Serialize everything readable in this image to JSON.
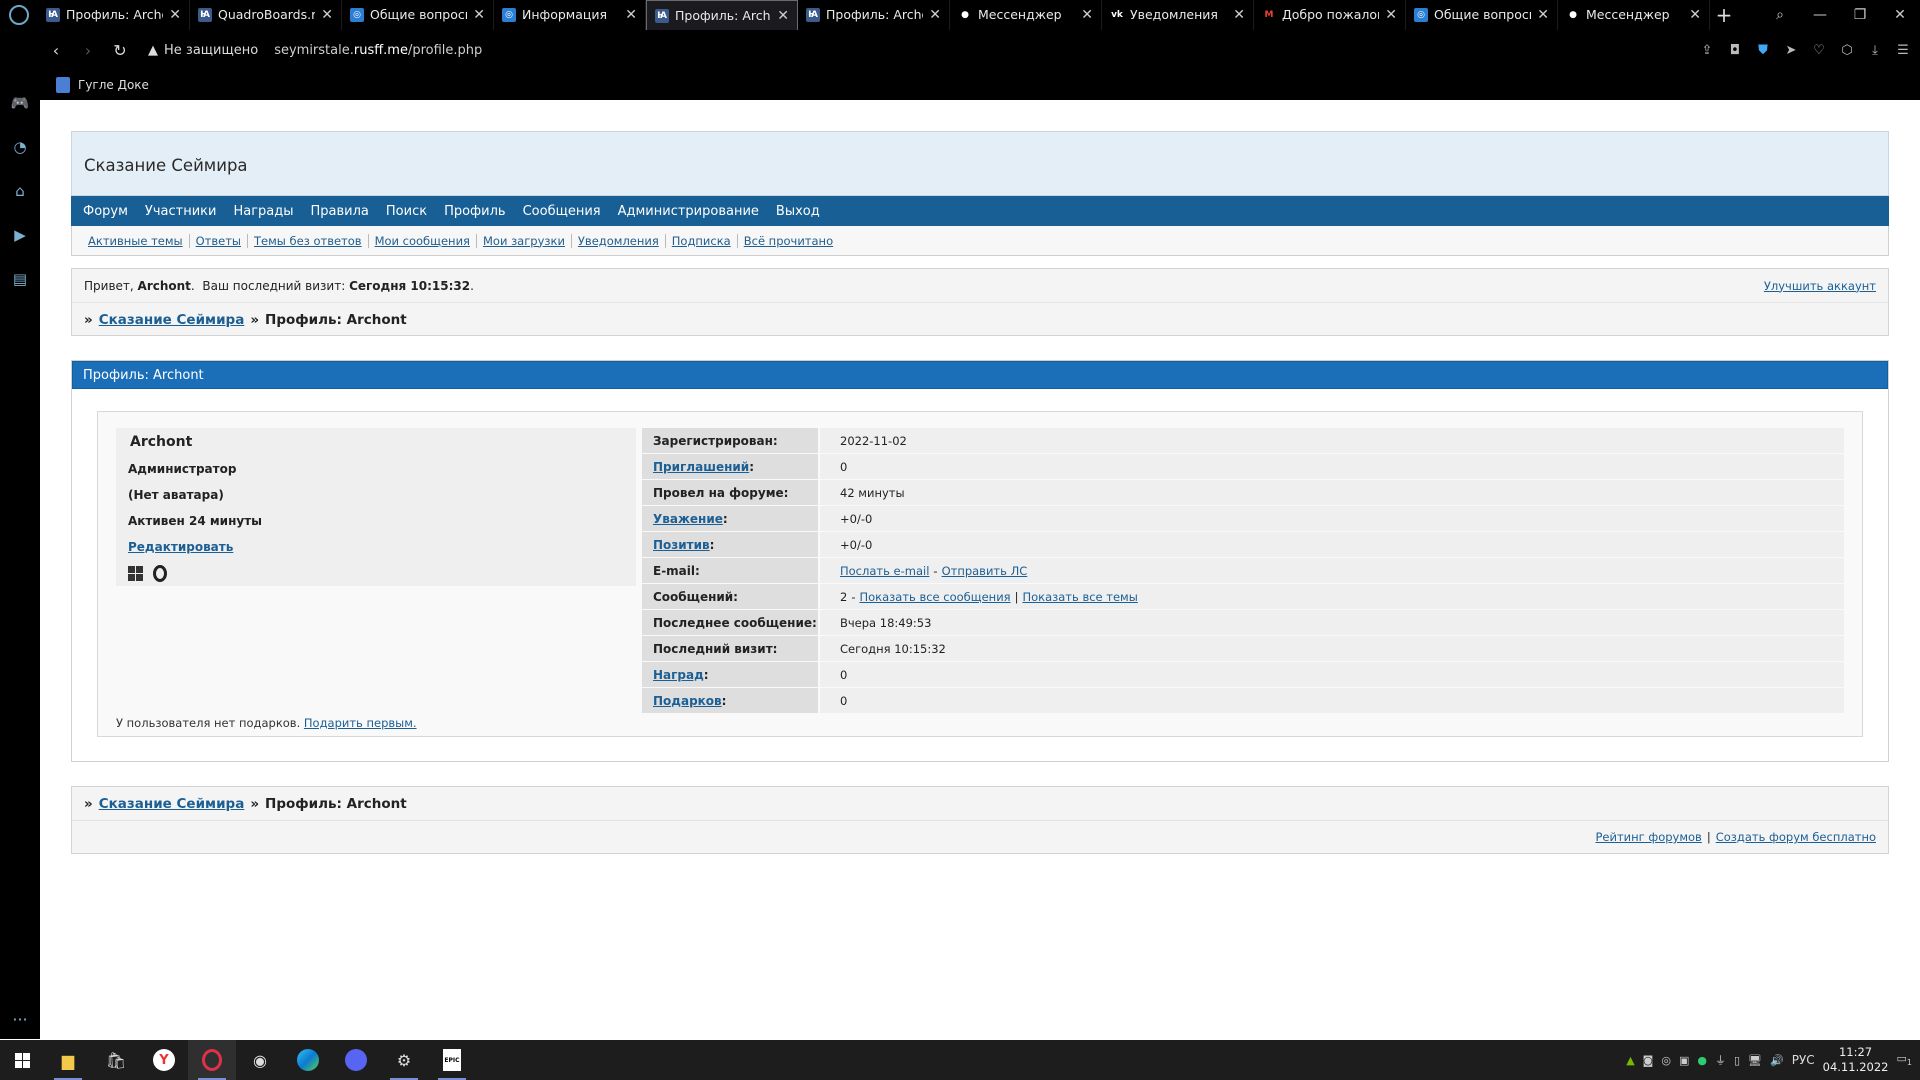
{
  "browser": {
    "tabs": [
      {
        "label": "Профиль: Archont",
        "favicon": "rusff",
        "active": false
      },
      {
        "label": "QuadroBoards.ru",
        "favicon": "rusff",
        "active": false
      },
      {
        "label": "Общие вопросы",
        "favicon": "quadro",
        "active": false
      },
      {
        "label": "Информация",
        "favicon": "quadro",
        "active": false
      },
      {
        "label": "Профиль: Archont",
        "favicon": "rusff",
        "active": true
      },
      {
        "label": "Профиль: Archont",
        "favicon": "rusff",
        "active": false
      },
      {
        "label": "Мессенджер",
        "favicon": "messenger",
        "active": false
      },
      {
        "label": "Уведомления",
        "favicon": "vk",
        "active": false
      },
      {
        "label": "Добро пожаловать",
        "favicon": "gmail",
        "active": false
      },
      {
        "label": "Общие вопросы",
        "favicon": "quadro",
        "active": false
      },
      {
        "label": "Мессенджер",
        "favicon": "messenger",
        "active": false
      }
    ],
    "security_label": "Не защищено",
    "url_prefix": "seymirstale.",
    "url_host": "rusff.me",
    "url_path": "/profile.php",
    "bookmark": "Гугле Доке"
  },
  "forum": {
    "title": "Сказание Сеймира",
    "nav": [
      "Форум",
      "Участники",
      "Награды",
      "Правила",
      "Поиск",
      "Профиль",
      "Сообщения",
      "Администрирование",
      "Выход"
    ],
    "subnav": [
      "Активные темы",
      "Ответы",
      "Темы без ответов",
      "Мои сообщения",
      "Мои загрузки",
      "Уведомления",
      "Подписка",
      "Всё прочитано"
    ],
    "welcome": {
      "greeting": "Привет,",
      "user": "Archont",
      "last_visit_label": "Ваш последний визит:",
      "last_visit_value": "Сегодня 10:15:32",
      "upgrade": "Улучшить аккаунт"
    },
    "breadcrumb": {
      "sep": "»",
      "home": "Сказание Сеймира",
      "current": "Профиль: Archont"
    }
  },
  "profile": {
    "heading": "Профиль: Archont",
    "username": "Archont",
    "role": "Администратор",
    "avatar": "(Нет аватара)",
    "active": "Активен 24 минуты",
    "edit": "Редактировать",
    "os_icons": [
      "windows-icon",
      "opera-icon"
    ],
    "gifts_text": "У пользователя нет подарков.",
    "gifts_link": "Подарить первым.",
    "stats": [
      {
        "key": "Зарегистрирован:",
        "link": false,
        "value": "2022-11-02"
      },
      {
        "key": "Приглашений",
        "link": true,
        "value": "0"
      },
      {
        "key": "Провел на форуме:",
        "link": false,
        "value": "42 минуты"
      },
      {
        "key": "Уважение",
        "link": true,
        "value": "+0/-0"
      },
      {
        "key": "Позитив",
        "link": true,
        "value": "+0/-0"
      },
      {
        "key": "E-mail:",
        "link": false,
        "value": ""
      },
      {
        "key": "Сообщений:",
        "link": false,
        "value": "2"
      },
      {
        "key": "Последнее сообщение:",
        "link": false,
        "value": "Вчера 18:49:53"
      },
      {
        "key": "Последний визит:",
        "link": false,
        "value": "Сегодня 10:15:32"
      },
      {
        "key": "Наград",
        "link": true,
        "value": "0"
      },
      {
        "key": "Подарков",
        "link": true,
        "value": "0"
      }
    ],
    "email_links": {
      "send_email": "Послать e-mail",
      "dash": "-",
      "send_pm": "Отправить ЛС"
    },
    "messages_links": {
      "dash": "-",
      "all_posts": "Показать все сообщения",
      "pipe": "|",
      "all_topics": "Показать все темы"
    }
  },
  "footer": {
    "rating": "Рейтинг форумов",
    "pipe": "|",
    "create": "Создать форум бесплатно"
  },
  "taskbar": {
    "lang": "РУС",
    "time": "11:27",
    "date": "04.11.2022",
    "notifications": "1"
  },
  "colors": {
    "nav_bg": "#175f94",
    "header_bg": "#e3eef7",
    "profile_head": "#1b6fb8",
    "link": "#1c5f94"
  }
}
